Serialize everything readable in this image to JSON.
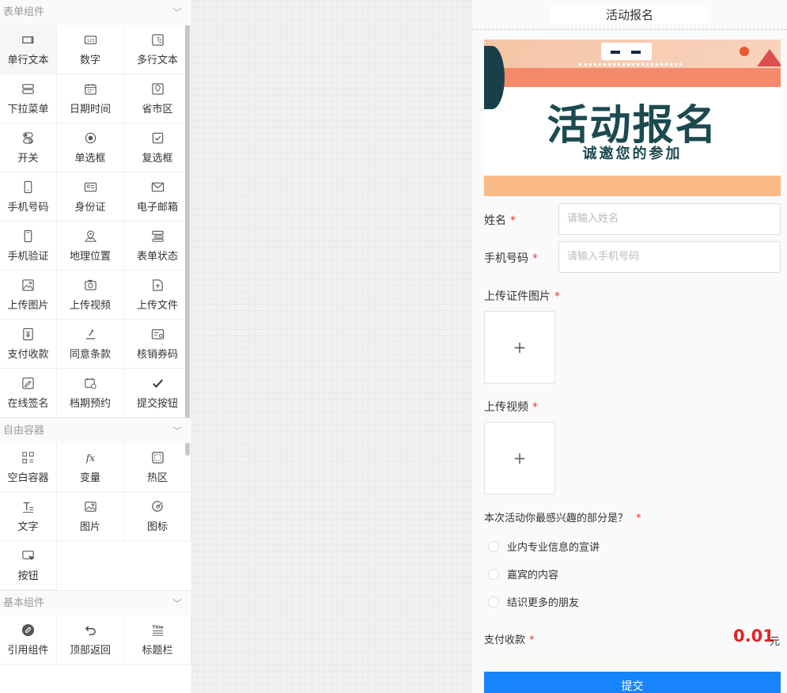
{
  "palette": {
    "sections": [
      {
        "title": "表单组件",
        "items": [
          {
            "label": "单行文本",
            "icon": "single-line-text-icon"
          },
          {
            "label": "数字",
            "icon": "number-icon"
          },
          {
            "label": "多行文本",
            "icon": "multi-line-text-icon"
          },
          {
            "label": "下拉菜单",
            "icon": "dropdown-icon"
          },
          {
            "label": "日期时间",
            "icon": "calendar-icon"
          },
          {
            "label": "省市区",
            "icon": "region-map-icon"
          },
          {
            "label": "开关",
            "icon": "switch-icon"
          },
          {
            "label": "单选框",
            "icon": "radio-icon"
          },
          {
            "label": "复选框",
            "icon": "checkbox-icon"
          },
          {
            "label": "手机号码",
            "icon": "phone-icon"
          },
          {
            "label": "身份证",
            "icon": "id-card-icon"
          },
          {
            "label": "电子邮箱",
            "icon": "mail-icon"
          },
          {
            "label": "手机验证",
            "icon": "phone-verify-icon"
          },
          {
            "label": "地理位置",
            "icon": "location-icon"
          },
          {
            "label": "表单状态",
            "icon": "form-status-icon"
          },
          {
            "label": "上传图片",
            "icon": "upload-image-icon"
          },
          {
            "label": "上传视频",
            "icon": "upload-video-icon"
          },
          {
            "label": "上传文件",
            "icon": "upload-file-icon"
          },
          {
            "label": "支付收款",
            "icon": "payment-icon"
          },
          {
            "label": "同意条款",
            "icon": "agree-terms-icon"
          },
          {
            "label": "核销券码",
            "icon": "coupon-icon"
          },
          {
            "label": "在线签名",
            "icon": "signature-icon"
          },
          {
            "label": "档期预约",
            "icon": "schedule-icon"
          },
          {
            "label": "提交按钮",
            "icon": "check-icon"
          }
        ]
      },
      {
        "title": "自由容器",
        "items": [
          {
            "label": "空白容器",
            "icon": "grid-container-icon"
          },
          {
            "label": "变量",
            "icon": "fx-icon"
          },
          {
            "label": "热区",
            "icon": "hotspot-icon"
          },
          {
            "label": "文字",
            "icon": "text-icon"
          },
          {
            "label": "图片",
            "icon": "image-icon"
          },
          {
            "label": "图标",
            "icon": "icon-icon"
          },
          {
            "label": "按钮",
            "icon": "button-icon"
          }
        ]
      },
      {
        "title": "基本组件",
        "items": [
          {
            "label": "引用组件",
            "icon": "link-component-icon"
          },
          {
            "label": "顶部返回",
            "icon": "back-icon"
          },
          {
            "label": "标题栏",
            "icon": "title-bar-icon"
          }
        ]
      }
    ]
  },
  "preview": {
    "page_title": "活动报名",
    "banner": {
      "headline": "活动报名",
      "subtitle": "诚邀您的参加"
    },
    "fields": {
      "name": {
        "label": "姓名",
        "placeholder": "请输入姓名"
      },
      "phone": {
        "label": "手机号码",
        "placeholder": "请输入手机号码"
      },
      "id_image": {
        "label": "上传证件图片"
      },
      "video": {
        "label": "上传视频"
      },
      "question": {
        "label": "本次活动你最感兴趣的部分是？"
      },
      "options": [
        "业内专业信息的宣讲",
        "嘉宾的内容",
        "结识更多的朋友"
      ],
      "payment": {
        "label": "支付收款",
        "amount": "0.01",
        "unit": "元"
      }
    },
    "required_mark": "*",
    "upload_plus": "+",
    "submit_label": "提交"
  },
  "colors": {
    "accent": "#1784fc",
    "required": "#e33333",
    "price": "#e82020",
    "banner_text": "#1c4a50"
  }
}
